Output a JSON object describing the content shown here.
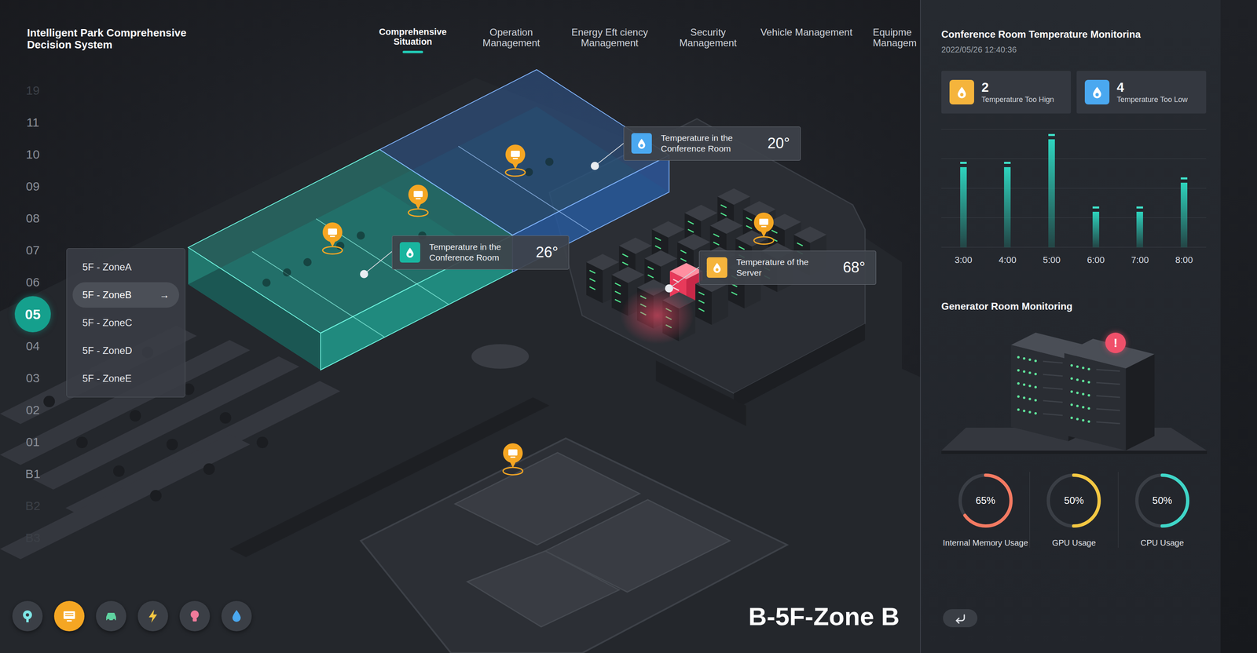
{
  "app_title": "Intelligent Park Comprehensive Decision System",
  "nav_tabs": [
    {
      "label": "Comprehensive Situation",
      "selected": true
    },
    {
      "label": "Operation Management",
      "selected": false
    },
    {
      "label": "Energy Eft ciency Management",
      "selected": false
    },
    {
      "label": "Security Management",
      "selected": false
    },
    {
      "label": "Vehicle Management",
      "selected": false
    },
    {
      "label": "Equipme Managem",
      "selected": false
    }
  ],
  "floors": [
    {
      "label": "19",
      "selected": false,
      "faded": true
    },
    {
      "label": "11",
      "selected": false,
      "faded": false
    },
    {
      "label": "10",
      "selected": false,
      "faded": false
    },
    {
      "label": "09",
      "selected": false,
      "faded": false
    },
    {
      "label": "08",
      "selected": false,
      "faded": false
    },
    {
      "label": "07",
      "selected": false,
      "faded": false
    },
    {
      "label": "06",
      "selected": false,
      "faded": false
    },
    {
      "label": "05",
      "selected": true,
      "faded": false
    },
    {
      "label": "04",
      "selected": false,
      "faded": false
    },
    {
      "label": "03",
      "selected": false,
      "faded": false
    },
    {
      "label": "02",
      "selected": false,
      "faded": false
    },
    {
      "label": "01",
      "selected": false,
      "faded": false
    },
    {
      "label": "B1",
      "selected": false,
      "faded": false
    },
    {
      "label": "B2",
      "selected": false,
      "faded": true
    },
    {
      "label": "B3",
      "selected": false,
      "faded": true
    }
  ],
  "zone_menu": [
    {
      "label": "5F - ZoneA",
      "selected": false
    },
    {
      "label": "5F - ZoneB",
      "selected": true
    },
    {
      "label": "5F - ZoneC",
      "selected": false
    },
    {
      "label": "5F - ZoneD",
      "selected": false
    },
    {
      "label": "5F - ZoneE",
      "selected": false
    }
  ],
  "zone_menu_arrow": "→",
  "map_labels": [
    {
      "title": "Temperature in the Conference Room",
      "value": "20°",
      "color": "#4aa8f0"
    },
    {
      "title": "Temperature in the Conference Room",
      "value": "26°",
      "color": "#19b59f"
    },
    {
      "title": "Temperature of the Server",
      "value": "68°",
      "color": "#f5b43c"
    }
  ],
  "toolbar": [
    {
      "kind": "location",
      "selected": false
    },
    {
      "kind": "monitor",
      "selected": true
    },
    {
      "kind": "car",
      "selected": false
    },
    {
      "kind": "power",
      "selected": false
    },
    {
      "kind": "bulb",
      "selected": false
    },
    {
      "kind": "drop",
      "selected": false
    }
  ],
  "zone_title": "B-5F-Zone B",
  "panel": {
    "title": "Conference Room Temperature Monitorina",
    "timestamp": "2022/05/26 12:40:36",
    "stats": [
      {
        "count": "2",
        "label": "Temperature Too Hign",
        "color": "#f5b43c"
      },
      {
        "count": "4",
        "label": "Temperature Too Low",
        "color": "#4aa8f0"
      }
    ],
    "chart": {
      "x_labels": [
        "3:00",
        "4:00",
        "5:00",
        "6:00",
        "7:00",
        "8:00"
      ],
      "values": [
        72,
        72,
        97,
        32,
        32,
        58
      ]
    },
    "generator_title": "Generator Room Monitoring",
    "alert": "!",
    "gauges": [
      {
        "value": "65%",
        "label": "Internal Memory Usage",
        "level": 0.65,
        "color": "#f47a62"
      },
      {
        "value": "50%",
        "label": "GPU Usage",
        "level": 0.5,
        "color": "#f5c842"
      },
      {
        "value": "50%",
        "label": "CPU Usage",
        "level": 0.5,
        "color": "#3fd6c8"
      }
    ]
  }
}
